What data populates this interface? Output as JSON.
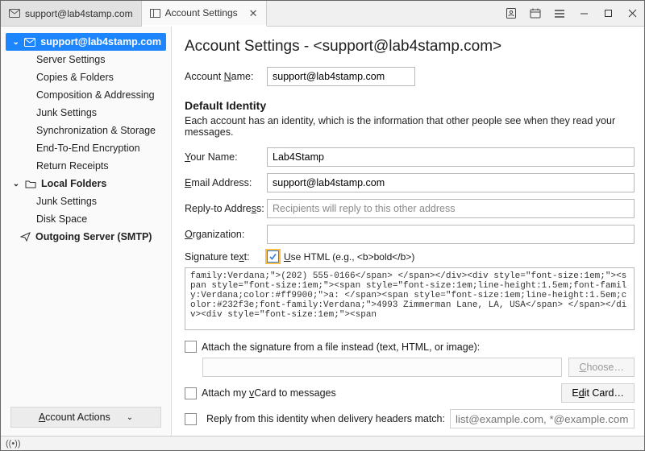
{
  "window": {
    "tabs": [
      {
        "label": "support@lab4stamp.com",
        "icon": "mail-icon"
      },
      {
        "label": "Account Settings",
        "icon": "settings-panel-icon"
      }
    ],
    "buttons": {
      "addressbook": "address-book-icon",
      "calendar": "calendar-icon",
      "menu": "hamburger-icon",
      "minimize": "–",
      "maximize": "□",
      "close": "✕"
    }
  },
  "sidebar": {
    "items": [
      {
        "label": "support@lab4stamp.com",
        "level": 1,
        "expandable": true,
        "selected": true,
        "icon": "mail-icon"
      },
      {
        "label": "Server Settings",
        "level": 2
      },
      {
        "label": "Copies & Folders",
        "level": 2
      },
      {
        "label": "Composition & Addressing",
        "level": 2
      },
      {
        "label": "Junk Settings",
        "level": 2
      },
      {
        "label": "Synchronization & Storage",
        "level": 2
      },
      {
        "label": "End-To-End Encryption",
        "level": 2
      },
      {
        "label": "Return Receipts",
        "level": 2
      },
      {
        "label": "Local Folders",
        "level": 1,
        "expandable": true,
        "icon": "folder-icon"
      },
      {
        "label": "Junk Settings",
        "level": 2
      },
      {
        "label": "Disk Space",
        "level": 2
      },
      {
        "label": "Outgoing Server (SMTP)",
        "level": 1,
        "expandable": false,
        "icon": "send-icon"
      }
    ],
    "account_actions": "Account Actions"
  },
  "main": {
    "heading_prefix": "Account Settings - ",
    "heading_email": "<support@lab4stamp.com>",
    "account_name_label": "Account Name:",
    "account_name_value": "support@lab4stamp.com",
    "identity_heading": "Default Identity",
    "identity_desc": "Each account has an identity, which is the information that other people see when they read your messages.",
    "your_name_label": "Your Name:",
    "your_name_value": "Lab4Stamp",
    "email_label": "Email Address:",
    "email_value": "support@lab4stamp.com",
    "replyto_label": "Reply-to Address:",
    "replyto_placeholder": "Recipients will reply to this other address",
    "org_label": "Organization:",
    "org_value": "",
    "sig_label": "Signature text:",
    "sig_usehtml_label": "Use HTML (e.g., <b>bold</b>)",
    "sig_text": "family:Verdana;\">(202) 555-0166</span> </span></div><div style=\"font-size:1em;\"><span style=\"font-size:1em;\"><span style=\"font-size:1em;line-height:1.5em;font-family:Verdana;color:#ff9900;\">a: </span><span style=\"font-size:1em;line-height:1.5em;color:#232f3e;font-family:Verdana;\">4993 Zimmerman Lane, LA, USA</span> </span></div><div style=\"font-size:1em;\"><span",
    "attach_file_label": "Attach the signature from a file instead (text, HTML, or image):",
    "choose_btn": "Choose…",
    "attach_vcard_label": "Attach my vCard to messages",
    "edit_card_btn": "Edit Card…",
    "reply_identity_label": "Reply from this identity when delivery headers match:",
    "reply_identity_placeholder": "list@example.com, *@example.com"
  },
  "underlines": {
    "account_name": "N",
    "your_name": "Y",
    "email": "E",
    "replyto": "s",
    "org": "O",
    "sigtext": "x",
    "usehtml": "U",
    "choose": "C",
    "vcard": "v",
    "editcard": "d",
    "acctactions": "A"
  }
}
